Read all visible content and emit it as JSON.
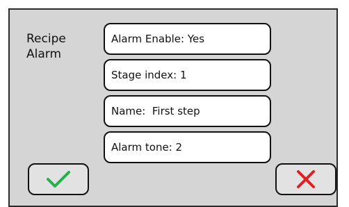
{
  "panel": {
    "title_line1": "Recipe",
    "title_line2": "Alarm"
  },
  "fields": [
    {
      "label": "Alarm Enable:",
      "value": "Yes"
    },
    {
      "label": "Stage index:",
      "value": "1"
    },
    {
      "label": "Name: ",
      "value": "First step"
    },
    {
      "label": "Alarm tone:",
      "value": "2"
    }
  ],
  "buttons": {
    "confirm_icon": "checkmark-icon",
    "cancel_icon": "x-icon",
    "confirm_color": "#22b14c",
    "cancel_color": "#e02020"
  }
}
